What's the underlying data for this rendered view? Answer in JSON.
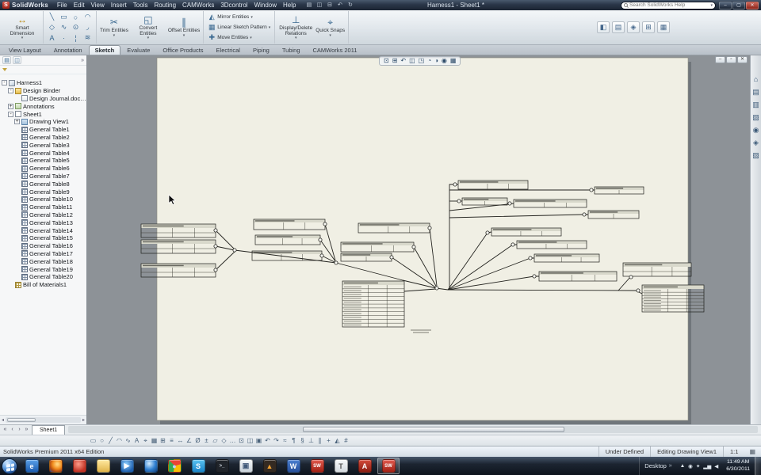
{
  "titlebar": {
    "app_name": "SolidWorks",
    "logo_letter": "S",
    "menus": [
      "File",
      "Edit",
      "View",
      "Insert",
      "Tools",
      "Routing",
      "CAMWorks",
      "3Dcontrol",
      "Window",
      "Help"
    ],
    "qat_icons": [
      {
        "name": "open-icon",
        "glyph": "▤"
      },
      {
        "name": "save-icon",
        "glyph": "◫"
      },
      {
        "name": "print-icon",
        "glyph": "⊟"
      },
      {
        "name": "undo-icon",
        "glyph": "↶"
      },
      {
        "name": "rebuild-icon",
        "glyph": "↻"
      }
    ],
    "document_title": "Harness1 - Sheet1 *",
    "search_placeholder": "Search SolidWorks Help",
    "window_controls": [
      {
        "name": "minimize-button",
        "glyph": "–"
      },
      {
        "name": "maximize-button",
        "glyph": "▢"
      },
      {
        "name": "close-button",
        "glyph": "✕"
      }
    ]
  },
  "ribbon": {
    "smart_dimension_label": "Smart Dimension",
    "smart_dimension_icon": "↔",
    "sketch_tool_icons": [
      {
        "name": "line-tool-icon",
        "glyph": "╲"
      },
      {
        "name": "rectangle-tool-icon",
        "glyph": "▭"
      },
      {
        "name": "circle-tool-icon",
        "glyph": "○"
      },
      {
        "name": "arc-tool-icon",
        "glyph": "◠"
      },
      {
        "name": "polygon-tool-icon",
        "glyph": "◇"
      },
      {
        "name": "spline-tool-icon",
        "glyph": "∿"
      },
      {
        "name": "ellipse-tool-icon",
        "glyph": "⊙"
      },
      {
        "name": "fillet-tool-icon",
        "glyph": "◞"
      },
      {
        "name": "text-tool-icon",
        "glyph": "A"
      },
      {
        "name": "point-tool-icon",
        "glyph": "·"
      },
      {
        "name": "centerline-tool-icon",
        "glyph": "¦"
      },
      {
        "name": "snap-tool-icon",
        "glyph": "≋"
      }
    ],
    "modify_buttons": [
      {
        "name": "trim-entities-button",
        "label": "Trim Entities",
        "icon_glyph": "✂"
      },
      {
        "name": "convert-entities-button",
        "label": "Convert Entities",
        "icon_glyph": "◱"
      },
      {
        "name": "offset-entities-button",
        "label": "Offset Entities",
        "icon_glyph": "∥"
      }
    ],
    "pattern_buttons": [
      {
        "name": "mirror-entities-button",
        "label": "Mirror Entities",
        "icon_glyph": "◭"
      },
      {
        "name": "linear-sketch-pattern-button",
        "label": "Linear Sketch Pattern",
        "icon_glyph": "▦"
      },
      {
        "name": "move-entities-button",
        "label": "Move Entities",
        "icon_glyph": "✚"
      }
    ],
    "relation_buttons": [
      {
        "name": "display-delete-relations-button",
        "label": "Display/Delete Relations",
        "icon_glyph": "⊥"
      },
      {
        "name": "quick-snaps-button",
        "label": "Quick Snaps",
        "icon_glyph": "⌖"
      }
    ],
    "extra_icons": [
      {
        "name": "ribbon-extra-icon-1",
        "glyph": "◧"
      },
      {
        "name": "ribbon-extra-icon-2",
        "glyph": "▤"
      },
      {
        "name": "ribbon-extra-icon-3",
        "glyph": "◈"
      },
      {
        "name": "ribbon-extra-icon-4",
        "glyph": "⊞"
      },
      {
        "name": "ribbon-extra-icon-5",
        "glyph": "▦"
      }
    ]
  },
  "tabs": {
    "items": [
      {
        "label": "View Layout",
        "active": false
      },
      {
        "label": "Annotation",
        "active": false
      },
      {
        "label": "Sketch",
        "active": true
      },
      {
        "label": "Evaluate",
        "active": false
      },
      {
        "label": "Office Products",
        "active": false
      },
      {
        "label": "Electrical",
        "active": false
      },
      {
        "label": "Piping",
        "active": false
      },
      {
        "label": "Tubing",
        "active": false
      },
      {
        "label": "CAMWorks 2011",
        "active": false
      }
    ]
  },
  "panel": {
    "header_icons": [
      {
        "name": "featuremanager-tab-icon",
        "glyph": "▤"
      },
      {
        "name": "propertymanager-tab-icon",
        "glyph": "◫"
      }
    ],
    "chevron": "»"
  },
  "feature_tree": {
    "items": [
      {
        "label": "Harness1",
        "icon": "harness",
        "depth": 0,
        "expand": "minus"
      },
      {
        "label": "Design Binder",
        "icon": "folder",
        "depth": 1,
        "expand": "minus"
      },
      {
        "label": "Design Journal.doc <Em",
        "icon": "doc",
        "depth": 2,
        "expand": null
      },
      {
        "label": "Annotations",
        "icon": "annotations",
        "depth": 1,
        "expand": "plus"
      },
      {
        "label": "Sheet1",
        "icon": "sheet",
        "depth": 1,
        "expand": "minus"
      },
      {
        "label": "Drawing View1",
        "icon": "view",
        "depth": 2,
        "expand": "plus"
      },
      {
        "label": "General Table1",
        "icon": "table",
        "depth": 2,
        "expand": null
      },
      {
        "label": "General Table2",
        "icon": "table",
        "depth": 2,
        "expand": null
      },
      {
        "label": "General Table3",
        "icon": "table",
        "depth": 2,
        "expand": null
      },
      {
        "label": "General Table4",
        "icon": "table",
        "depth": 2,
        "expand": null
      },
      {
        "label": "General Table5",
        "icon": "table",
        "depth": 2,
        "expand": null
      },
      {
        "label": "General Table6",
        "icon": "table",
        "depth": 2,
        "expand": null
      },
      {
        "label": "General Table7",
        "icon": "table",
        "depth": 2,
        "expand": null
      },
      {
        "label": "General Table8",
        "icon": "table",
        "depth": 2,
        "expand": null
      },
      {
        "label": "General Table9",
        "icon": "table",
        "depth": 2,
        "expand": null
      },
      {
        "label": "General Table10",
        "icon": "table",
        "depth": 2,
        "expand": null
      },
      {
        "label": "General Table11",
        "icon": "table",
        "depth": 2,
        "expand": null
      },
      {
        "label": "General Table12",
        "icon": "table",
        "depth": 2,
        "expand": null
      },
      {
        "label": "General Table13",
        "icon": "table",
        "depth": 2,
        "expand": null
      },
      {
        "label": "General Table14",
        "icon": "table",
        "depth": 2,
        "expand": null
      },
      {
        "label": "General Table15",
        "icon": "table",
        "depth": 2,
        "expand": null
      },
      {
        "label": "General Table16",
        "icon": "table",
        "depth": 2,
        "expand": null
      },
      {
        "label": "General Table17",
        "icon": "table",
        "depth": 2,
        "expand": null
      },
      {
        "label": "General Table18",
        "icon": "table",
        "depth": 2,
        "expand": null
      },
      {
        "label": "General Table19",
        "icon": "table",
        "depth": 2,
        "expand": null
      },
      {
        "label": "General Table20",
        "icon": "table",
        "depth": 2,
        "expand": null
      },
      {
        "label": "Bill of Materials1",
        "icon": "bom",
        "depth": 1,
        "expand": null
      }
    ]
  },
  "headsup_toolbar": {
    "icons": [
      {
        "name": "zoom-fit-icon",
        "glyph": "⊡"
      },
      {
        "name": "zoom-area-icon",
        "glyph": "⊞"
      },
      {
        "name": "previous-view-icon",
        "glyph": "↶"
      },
      {
        "name": "section-view-icon",
        "glyph": "◫"
      },
      {
        "name": "view-orientation-icon",
        "glyph": "◳"
      },
      {
        "name": "display-style-icon",
        "glyph": "◔"
      },
      {
        "name": "hide-show-icon",
        "glyph": "◑"
      },
      {
        "name": "appearance-icon",
        "glyph": "◉"
      },
      {
        "name": "scene-icon",
        "glyph": "▦"
      }
    ]
  },
  "graphics": {
    "doc_window_controls": [
      {
        "name": "doc-minimize-button",
        "glyph": "–"
      },
      {
        "name": "doc-restore-button",
        "glyph": "▫"
      },
      {
        "name": "doc-close-button",
        "glyph": "✕"
      }
    ]
  },
  "task_pane": {
    "icons": [
      {
        "name": "resources-icon",
        "glyph": "⌂"
      },
      {
        "name": "design-library-icon",
        "glyph": "▤"
      },
      {
        "name": "file-explorer-icon",
        "glyph": "▥"
      },
      {
        "name": "view-palette-icon",
        "glyph": "▧"
      },
      {
        "name": "appearances-icon",
        "glyph": "◉"
      },
      {
        "name": "scenes-icon",
        "glyph": "◈"
      },
      {
        "name": "custom-properties-icon",
        "glyph": "▨"
      }
    ]
  },
  "sheet_bar": {
    "nav_icons": [
      {
        "name": "sheet-nav-first-icon",
        "glyph": "«"
      },
      {
        "name": "sheet-nav-prev-icon",
        "glyph": "‹"
      },
      {
        "name": "sheet-nav-next-icon",
        "glyph": "›"
      },
      {
        "name": "sheet-nav-last-icon",
        "glyph": "»"
      }
    ],
    "sheet_tab_label": "Sheet1"
  },
  "bottom_toolbar": {
    "icons": [
      "▭",
      "○",
      "╱",
      "◠",
      "∿",
      "A",
      "⌖",
      "▦",
      "⊞",
      "≡",
      "↔",
      "∠",
      "Ø",
      "±",
      "▱",
      "◇",
      "…",
      "⊡",
      "◫",
      "▣",
      "↶",
      "↷",
      "≈",
      "¶",
      "§",
      "⊥",
      "∥",
      "+",
      "◭",
      "#"
    ]
  },
  "status_bar": {
    "left_text": "SolidWorks Premium 2011 x64 Edition",
    "items": [
      "Under Defined",
      "Editing Drawing View1",
      "1:1"
    ],
    "grid_icon": "▦"
  },
  "taskbar": {
    "desktop_label": "Desktop",
    "chevron": "»",
    "icons": [
      {
        "name": "taskbar-internet-explorer",
        "glyph": "e",
        "fg": "#ffffff",
        "bg": "linear-gradient(#5aa0e8,#1b5cb0)"
      },
      {
        "name": "taskbar-firefox",
        "glyph": "",
        "fg": "#ffffff",
        "bg": "radial-gradient(circle at 62% 35%, #ffd27a 8%, #f08a1d 45%, #b14a12 72%, #35508c 100%)"
      },
      {
        "name": "taskbar-launcher",
        "glyph": "",
        "fg": "#ffffff",
        "bg": "radial-gradient(circle at 40% 35%, #ff9c8a, #c23325 70%)"
      },
      {
        "name": "taskbar-explorer",
        "glyph": "",
        "fg": "#7a5c16",
        "bg": "linear-gradient(#ffe9a0,#e0b44a)"
      },
      {
        "name": "taskbar-media-player",
        "glyph": "▶",
        "fg": "#ffffff",
        "bg": "radial-gradient(circle at 40% 35%, #8fd0ff, #1e5fae 75%)"
      },
      {
        "name": "taskbar-messenger",
        "glyph": "",
        "fg": "#ffffff",
        "bg": "radial-gradient(circle at 35% 30%, #d2ecff, #2f7fd0 55%, #123d78)"
      },
      {
        "name": "taskbar-chrome",
        "glyph": "●",
        "fg": "#bcd4f8",
        "bg": "conic-gradient(from -45deg, #ea4335 0 33%, #fbbc05 0 66%, #34a853 0 100%)"
      },
      {
        "name": "taskbar-skype",
        "glyph": "S",
        "fg": "#ffffff",
        "bg": "linear-gradient(#59c2f0,#1a84c8)"
      },
      {
        "name": "taskbar-console",
        "glyph": ">_",
        "fg": "#cfd6de",
        "bg": "#20242a"
      },
      {
        "name": "taskbar-notepad",
        "glyph": "▣",
        "fg": "#41597a",
        "bg": "linear-gradient(#f4f7fa,#c9d2da)"
      },
      {
        "name": "taskbar-vlc",
        "glyph": "▲",
        "fg": "#f0a030",
        "bg": "#342a22"
      },
      {
        "name": "taskbar-word",
        "glyph": "W",
        "fg": "#ffffff",
        "bg": "linear-gradient(#4a7fd0,#27509b)"
      },
      {
        "name": "taskbar-solidworks-1",
        "glyph": "SW",
        "fg": "#ffffff",
        "bg": "linear-gradient(#e05a4e,#a32014)"
      },
      {
        "name": "taskbar-texteditor",
        "glyph": "T",
        "fg": "#555555",
        "bg": "linear-gradient(#f6f8fa,#d4dae0)"
      },
      {
        "name": "taskbar-adobe",
        "glyph": "A",
        "fg": "#ffffff",
        "bg": "linear-gradient(#d44a3a,#8c1d12)"
      },
      {
        "name": "taskbar-solidworks-active",
        "glyph": "SW",
        "fg": "#ffffff",
        "bg": "linear-gradient(#e05a4e,#a32014)",
        "active": true
      }
    ],
    "tray_icons": [
      "▲",
      "◉",
      "✦",
      "▂▅",
      "◀"
    ],
    "clock_time": "11:49 AM",
    "clock_date": "6/30/2011"
  }
}
